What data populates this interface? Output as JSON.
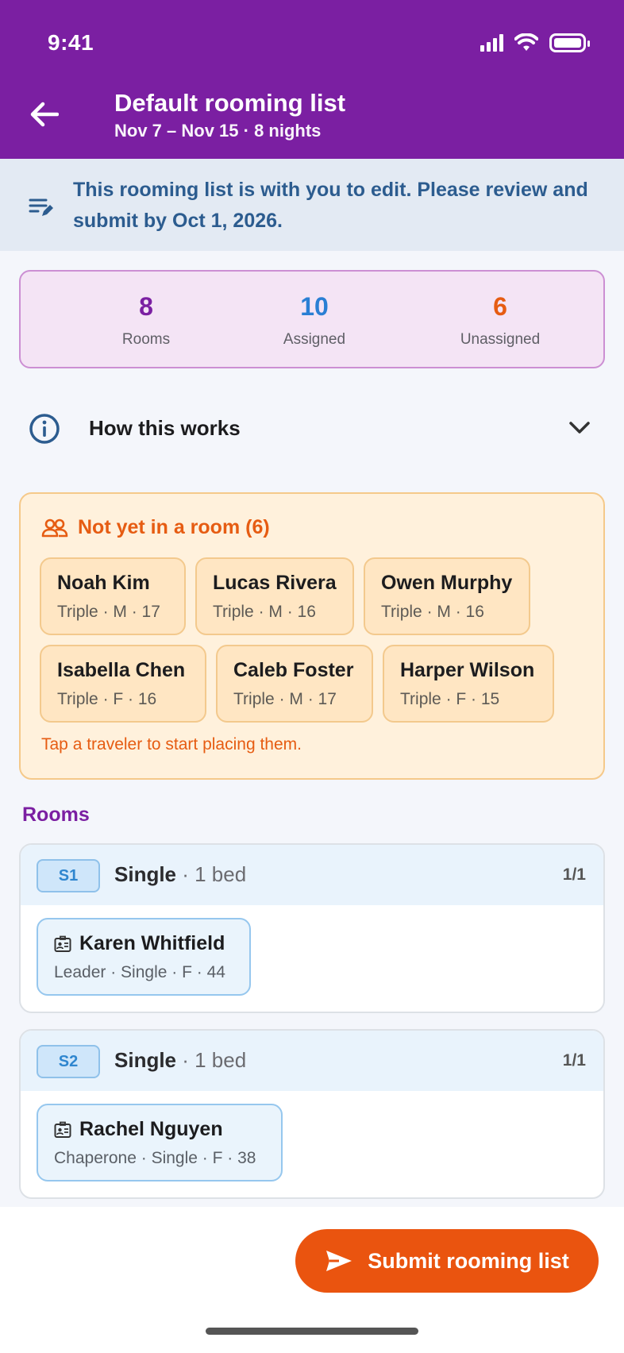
{
  "status_bar": {
    "time": "9:41"
  },
  "header": {
    "title": "Default rooming list",
    "subtitle": "Nov 7 – Nov 15 · 8 nights",
    "colors": {
      "background": "#7b1fa2"
    }
  },
  "notice": {
    "text": "This rooming list is with you to edit. Please review and submit by Oct 1, 2026.",
    "icon": "edit-list-icon"
  },
  "stats": {
    "rooms": {
      "value": "8",
      "label": "Rooms",
      "color": "#7b1fa2"
    },
    "assigned": {
      "value": "10",
      "label": "Assigned",
      "color": "#2a7fd4"
    },
    "unassigned": {
      "value": "6",
      "label": "Unassigned",
      "color": "#e65c12"
    }
  },
  "how_it_works": {
    "label": "How this works",
    "expanded": false
  },
  "unassigned_section": {
    "title": "Not yet in a room (6)",
    "hint": "Tap a traveler to start placing them.",
    "travelers": [
      {
        "name": "Noah Kim",
        "meta": "Triple · M · 17"
      },
      {
        "name": "Lucas Rivera",
        "meta": "Triple · M · 16"
      },
      {
        "name": "Owen Murphy",
        "meta": "Triple · M · 16"
      },
      {
        "name": "Isabella Chen",
        "meta": "Triple · F · 16"
      },
      {
        "name": "Caleb Foster",
        "meta": "Triple · M · 17"
      },
      {
        "name": "Harper Wilson",
        "meta": "Triple · F · 15"
      }
    ]
  },
  "rooms": {
    "heading": "Rooms",
    "items": [
      {
        "code": "S1",
        "type": "Single",
        "beds": " · 1 bed",
        "occupancy": "1/1",
        "occupant": {
          "name": "Karen Whitfield",
          "meta": "Leader · Single · F · 44"
        }
      },
      {
        "code": "S2",
        "type": "Single",
        "beds": " · 1 bed",
        "occupancy": "1/1",
        "occupant": {
          "name": "Rachel Nguyen",
          "meta": "Chaperone · Single · F · 38"
        }
      }
    ]
  },
  "submit": {
    "label": "Submit rooming list",
    "color": "#ea540f"
  }
}
